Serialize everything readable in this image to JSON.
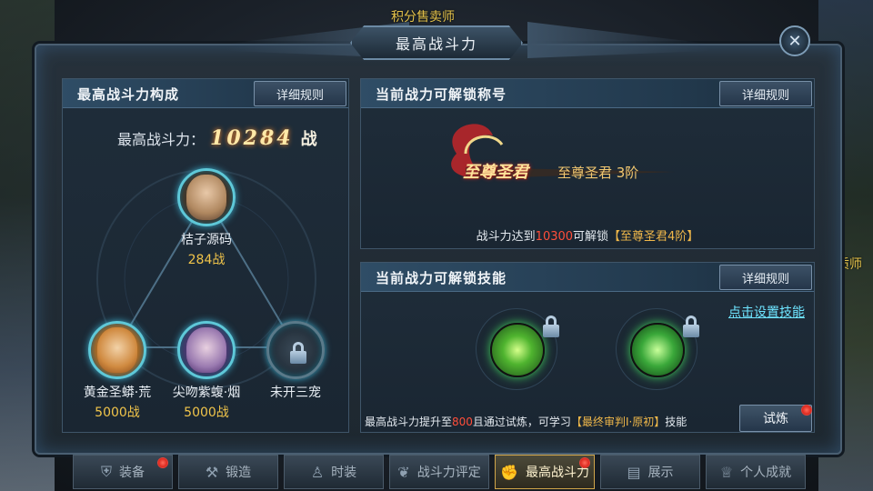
{
  "world": {
    "npc_top": "积分售卖师",
    "npc_right": "质师"
  },
  "window": {
    "title": "最高战斗力",
    "close_icon": "close-x-icon"
  },
  "composition": {
    "header": "最高战斗力构成",
    "rules_label": "详细规则",
    "power_label": "最高战斗力：",
    "power_value": "10284",
    "power_unit": "战",
    "pets": [
      {
        "name": "桔子源码",
        "power": "284战"
      },
      {
        "name": "黄金圣蟒·荒",
        "power": "5000战"
      },
      {
        "name": "尖吻紫蝮·烟",
        "power": "5000战"
      },
      {
        "name": "未开三宠",
        "power": ""
      }
    ]
  },
  "title_unlock": {
    "header": "当前战力可解锁称号",
    "rules_label": "详细规则",
    "badge_text": "至尊圣君",
    "title_name": "至尊圣君 3阶",
    "unlock_prefix": "战斗力达到",
    "unlock_value": "10300",
    "unlock_mid": "可解锁",
    "unlock_reward": "【至尊圣君4阶】"
  },
  "skill_unlock": {
    "header": "当前战力可解锁技能",
    "rules_label": "详细规则",
    "set_skill_link": "点击设置技能",
    "tip_prefix": "最高战斗力提升至",
    "tip_value": "800",
    "tip_mid": "且通过试炼，可学习",
    "tip_skill": "【最终审判Ⅰ·原初】",
    "tip_suffix": "技能",
    "trial_label": "试炼"
  },
  "tabs": [
    {
      "label": "装备",
      "icon": "armor-icon",
      "badge": true
    },
    {
      "label": "锻造",
      "icon": "anvil-icon",
      "badge": false
    },
    {
      "label": "时装",
      "icon": "shirt-icon",
      "badge": false
    },
    {
      "label": "战斗力评定",
      "icon": "wings-icon",
      "badge": false
    },
    {
      "label": "最高战斗力",
      "icon": "fist-icon",
      "badge": true,
      "active": true
    },
    {
      "label": "展示",
      "icon": "display-icon",
      "badge": false
    },
    {
      "label": "个人成就",
      "icon": "trophy-icon",
      "badge": false
    }
  ]
}
